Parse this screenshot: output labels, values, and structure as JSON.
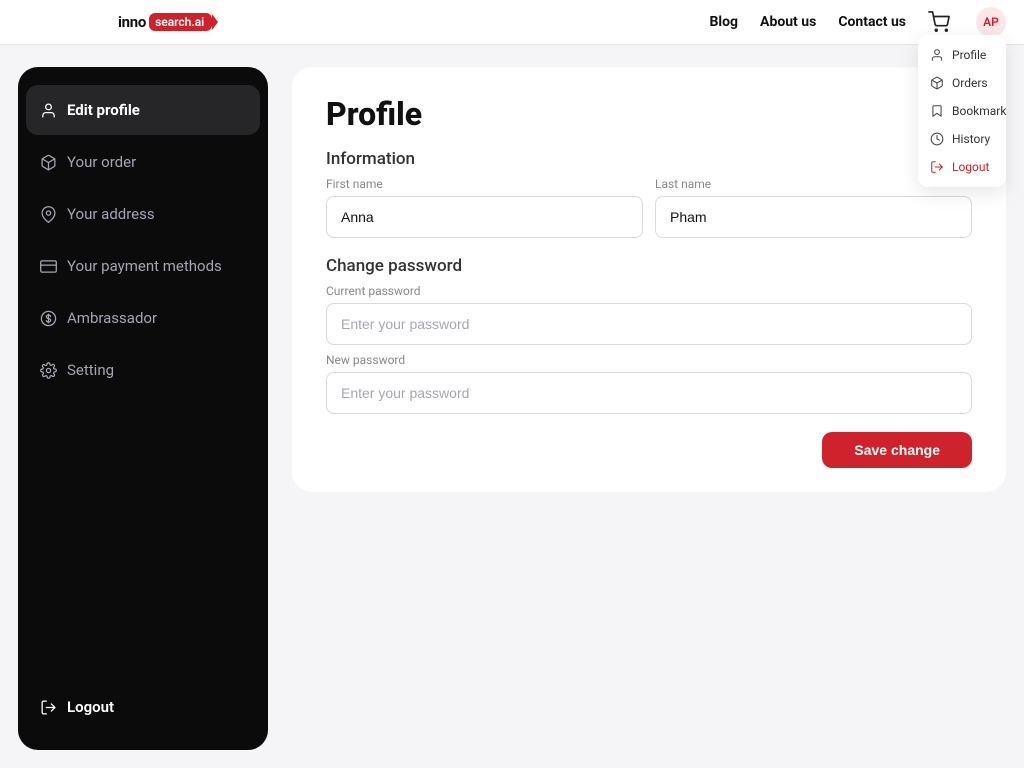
{
  "header": {
    "logo": {
      "prefix": "inno",
      "badge": "search.ai"
    },
    "nav": {
      "blog": "Blog",
      "about": "About us",
      "contact": "Contact us"
    },
    "avatar": "AP"
  },
  "dropdown": {
    "profile": "Profile",
    "orders": "Orders",
    "bookmark": "Bookmark",
    "history": "History",
    "logout": "Logout"
  },
  "sidebar": {
    "edit_profile": "Edit profile",
    "your_order": "Your order",
    "your_address": "Your address",
    "payment_methods": "Your payment methods",
    "ambassador": "Ambrassador",
    "setting": "Setting",
    "logout": "Logout"
  },
  "profile": {
    "title": "Profile",
    "information_heading": "Information",
    "first_name_label": "First name",
    "first_name_value": "Anna",
    "last_name_label": "Last name",
    "last_name_value": "Pham",
    "change_password_heading": "Change password",
    "current_password_label": "Current password",
    "current_password_placeholder": "Enter your password",
    "new_password_label": "New password",
    "new_password_placeholder": "Enter your password",
    "save_button": "Save change"
  }
}
